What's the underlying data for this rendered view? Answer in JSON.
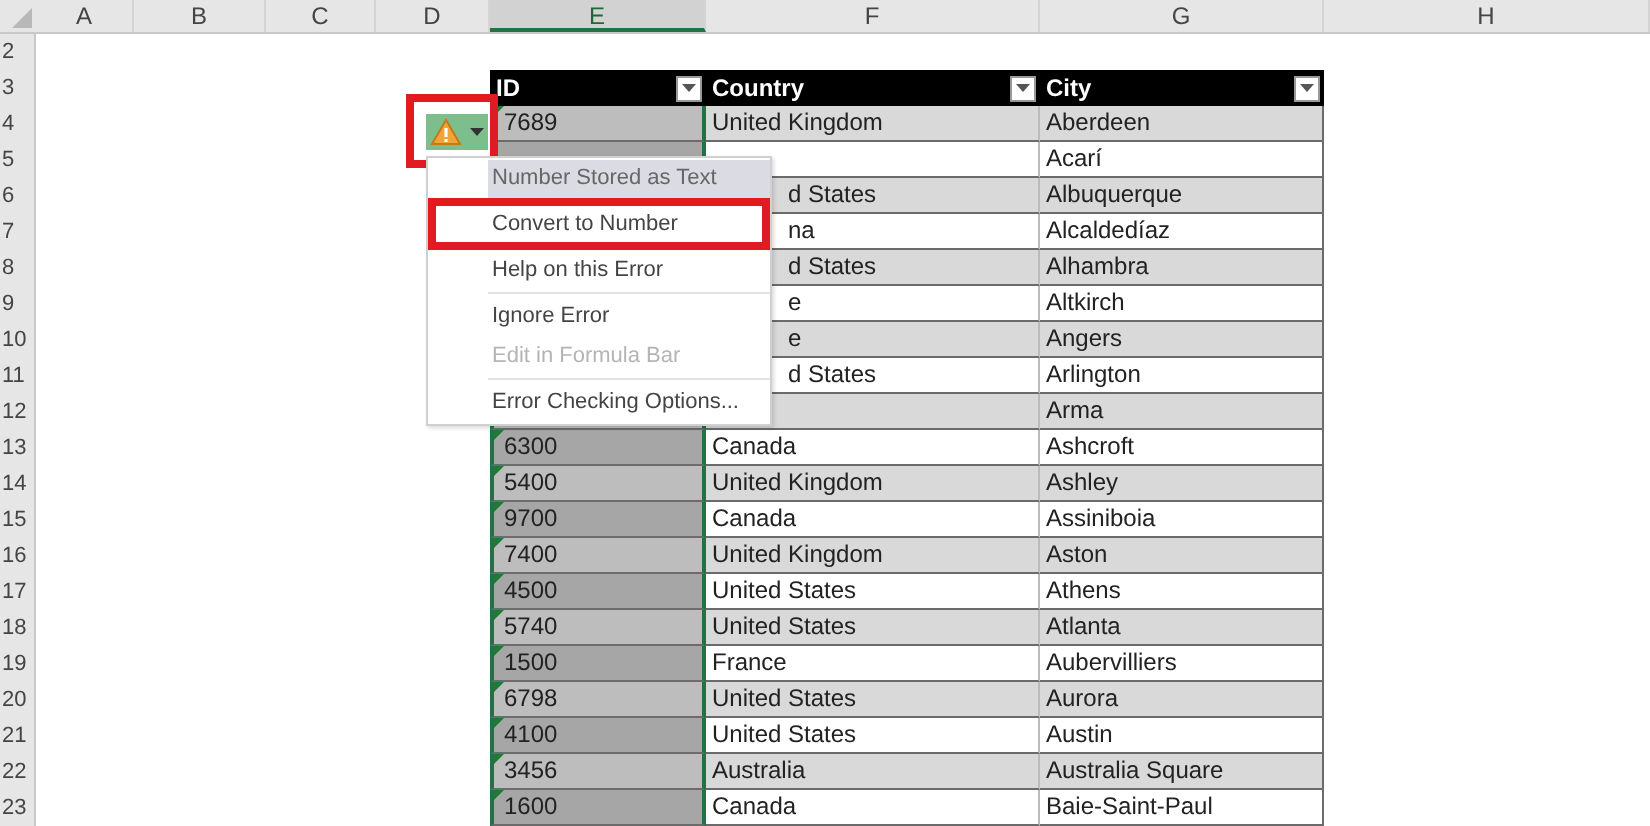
{
  "columns": [
    {
      "label": "A",
      "selected": false
    },
    {
      "label": "B",
      "selected": false
    },
    {
      "label": "C",
      "selected": false
    },
    {
      "label": "D",
      "selected": false
    },
    {
      "label": "E",
      "selected": true
    },
    {
      "label": "F",
      "selected": false
    },
    {
      "label": "G",
      "selected": false
    },
    {
      "label": "H",
      "selected": false
    }
  ],
  "row_numbers": [
    "2",
    "3",
    "4",
    "5",
    "6",
    "7",
    "8",
    "9",
    "10",
    "11",
    "12",
    "13",
    "14",
    "15",
    "16",
    "17",
    "18",
    "19",
    "20",
    "21",
    "22",
    "23"
  ],
  "table": {
    "columns": [
      "ID",
      "Country",
      "City"
    ],
    "rows": [
      {
        "id": "7689",
        "country": "United Kingdom",
        "city": "Aberdeen",
        "error": true
      },
      {
        "city": "Acarí"
      },
      {
        "country": "d States",
        "city": "Albuquerque"
      },
      {
        "country": "na",
        "city": "Alcaldedíaz"
      },
      {
        "country": "d States",
        "city": "Alhambra"
      },
      {
        "country": "e",
        "city": "Altkirch"
      },
      {
        "country": "e",
        "city": "Angers"
      },
      {
        "country": "d States",
        "city": "Arlington"
      },
      {
        "city": "Arma"
      },
      {
        "id": "6300",
        "country": "Canada",
        "city": "Ashcroft",
        "error": true
      },
      {
        "id": "5400",
        "country": "United Kingdom",
        "city": "Ashley",
        "error": true
      },
      {
        "id": "9700",
        "country": "Canada",
        "city": "Assiniboia",
        "error": true
      },
      {
        "id": "7400",
        "country": "United Kingdom",
        "city": "Aston",
        "error": true
      },
      {
        "id": "4500",
        "country": "United States",
        "city": "Athens",
        "error": true
      },
      {
        "id": "5740",
        "country": "United States",
        "city": "Atlanta",
        "error": true
      },
      {
        "id": "1500",
        "country": "France",
        "city": "Aubervilliers",
        "error": true
      },
      {
        "id": "6798",
        "country": "United States",
        "city": "Aurora",
        "error": true
      },
      {
        "id": "4100",
        "country": "United States",
        "city": "Austin",
        "error": true
      },
      {
        "id": "3456",
        "country": "Australia",
        "city": "Australia Square",
        "error": true
      },
      {
        "id": "1600",
        "country": "Canada",
        "city": "Baie-Saint-Paul",
        "error": true
      }
    ]
  },
  "error_button": {
    "highlighted": true
  },
  "error_menu": {
    "items": [
      {
        "kind": "header",
        "label": "Number Stored as Text"
      },
      {
        "kind": "item",
        "label": "Convert to Number",
        "disabled": false,
        "highlighted": true
      },
      {
        "kind": "item",
        "label": "Help on this Error",
        "disabled": false,
        "highlighted": false
      },
      {
        "kind": "separator"
      },
      {
        "kind": "item",
        "label": "Ignore Error",
        "disabled": false,
        "highlighted": false
      },
      {
        "kind": "item",
        "label": "Edit in Formula Bar",
        "disabled": true,
        "highlighted": false
      },
      {
        "kind": "separator"
      },
      {
        "kind": "item",
        "label": "Error Checking Options...",
        "disabled": false,
        "highlighted": false
      }
    ]
  }
}
